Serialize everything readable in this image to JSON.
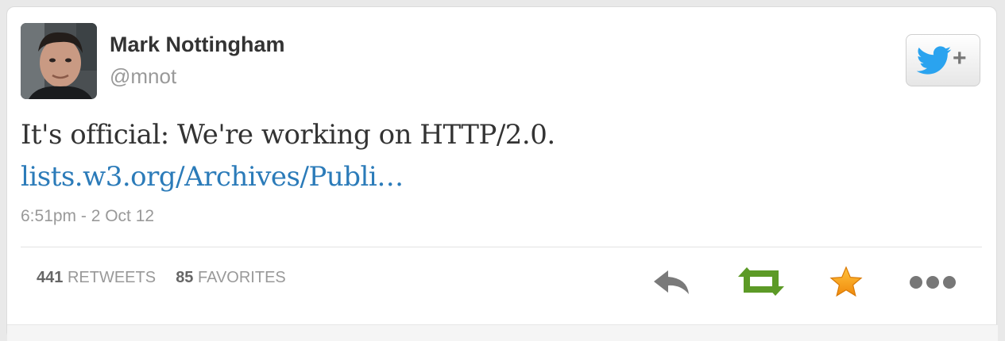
{
  "tweet": {
    "author_name": "Mark Nottingham",
    "author_handle": "@mnot",
    "text": "It's official: We're working on HTTP/2.0.",
    "link_text": "lists.w3.org/Archives/Publi…",
    "timestamp": "6:51pm - 2 Oct 12"
  },
  "stats": {
    "retweets_count": "441",
    "retweets_label": "RETWEETS",
    "favorites_count": "85",
    "favorites_label": "FAVORITES"
  },
  "follow_button": {
    "plus": "+",
    "icon": "twitter-bird-icon"
  },
  "actions": {
    "reply_icon": "reply-icon",
    "retweet_icon": "retweet-icon",
    "favorite_icon": "star-icon",
    "more_icon": "more-dots-icon"
  },
  "colors": {
    "link": "#2b7bb9",
    "twitter_blue": "#2aa3ef",
    "retweet_green": "#5c9a26",
    "favorite_orange": "#f39c12"
  }
}
